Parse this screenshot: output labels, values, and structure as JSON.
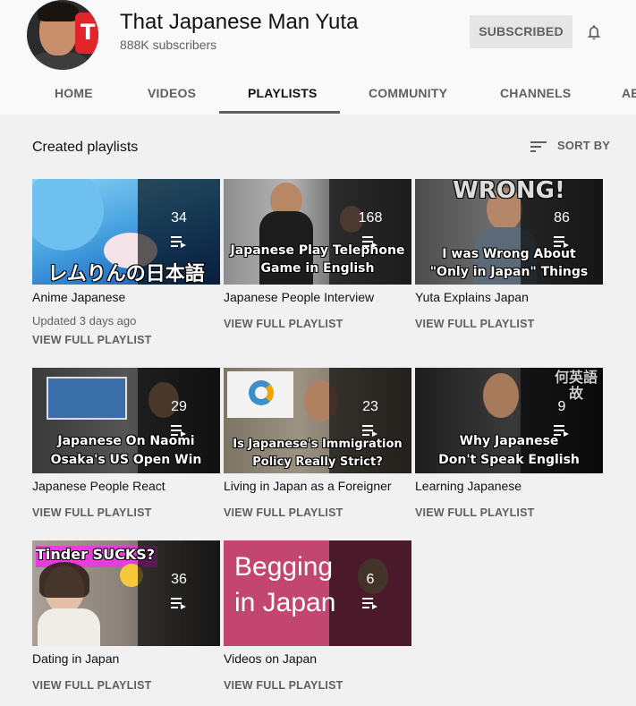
{
  "channel": {
    "title": "That Japanese Man Yuta",
    "subscribers": "888K subscribers",
    "subscribe_label": "SUBSCRIBED",
    "brand_color": "#e2242b"
  },
  "tabs": [
    {
      "label": "HOME"
    },
    {
      "label": "VIDEOS"
    },
    {
      "label": "PLAYLISTS"
    },
    {
      "label": "COMMUNITY"
    },
    {
      "label": "CHANNELS"
    },
    {
      "label": "AB"
    }
  ],
  "section": {
    "title": "Created playlists",
    "sort_label": "SORT BY"
  },
  "playlists": [
    {
      "title": "Anime Japanese",
      "count": "34",
      "updated": "Updated 3 days ago",
      "view_label": "VIEW FULL PLAYLIST",
      "caption": "レムりんの日本語"
    },
    {
      "title": "Japanese People Interview",
      "count": "168",
      "view_label": "VIEW FULL PLAYLIST",
      "caption_line1": "Japanese Play Telephone",
      "caption_line2": "Game in English"
    },
    {
      "title": "Yuta Explains Japan",
      "count": "86",
      "view_label": "VIEW FULL PLAYLIST",
      "caption_top": "WRONG!",
      "caption_line1": "I was Wrong About",
      "caption_line2": "\"Only in Japan\" Things"
    },
    {
      "title": "Japanese People React",
      "count": "29",
      "view_label": "VIEW FULL PLAYLIST",
      "caption_line1": "Japanese On Naomi",
      "caption_line2": "Osaka's US Open Win"
    },
    {
      "title": "Living in Japan as a Foreigner",
      "count": "23",
      "view_label": "VIEW FULL PLAYLIST",
      "caption_line1": "Is Japanese's Immigration",
      "caption_line2": "Policy Really Strict?"
    },
    {
      "title": "Learning Japanese",
      "count": "9",
      "view_label": "VIEW FULL PLAYLIST",
      "caption_top": "何英語故",
      "caption_line1": "Why Japanese",
      "caption_line2": "Don't Speak English"
    },
    {
      "title": "Dating in Japan",
      "count": "36",
      "view_label": "VIEW FULL PLAYLIST",
      "caption_top": "Tinder SUCKS?"
    },
    {
      "title": "Videos on Japan",
      "count": "6",
      "view_label": "VIEW FULL PLAYLIST",
      "caption_line1": "Begging",
      "caption_line2": "in Japan"
    }
  ]
}
